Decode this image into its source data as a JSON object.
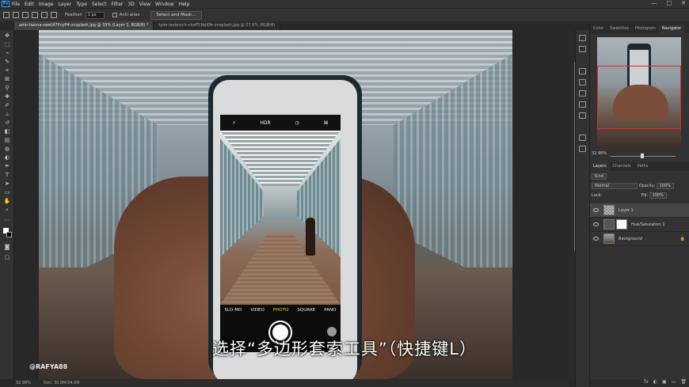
{
  "app": {
    "logo_text": "Ps"
  },
  "menu": [
    "File",
    "Edit",
    "Image",
    "Layer",
    "Type",
    "Select",
    "Filter",
    "3D",
    "View",
    "Window",
    "Help"
  ],
  "window_controls": [
    "—",
    "□",
    "✕"
  ],
  "options": {
    "feather_label": "Feather:",
    "feather_value": "1 px",
    "antialias_label": "Anti-alias",
    "select_mask_label": "Select and Mask..."
  },
  "tabs": [
    {
      "label": "amir-hanna-sweUf7FcyP4-unsplash.jpg @ 33% (Layer 1, RGB/8) *"
    },
    {
      "label": "tyler-lastovich-nhzP53bjlOk-unsplash.jpg @ 27.5% (RGB/8)"
    }
  ],
  "camera": {
    "top": [
      "⚡",
      "HDR",
      "◷",
      "⌘"
    ],
    "modes": [
      "SLO-MO",
      "VIDEO",
      "PHOTO",
      "SQUARE",
      "PANO"
    ],
    "selected_mode": "PHOTO"
  },
  "subtitle": "选择“多边形套索工具”（快捷键L）",
  "watermark": "@RAFYA88",
  "status": {
    "zoom": "32.98%",
    "doc": "Doc: 30.0M/34.0M"
  },
  "panels": {
    "top_tabs": [
      "Color",
      "Swatches",
      "Histogram",
      "Navigator"
    ],
    "top_active": "Navigator",
    "nav_zoom": "32.98%",
    "layer_tabs": [
      "Layers",
      "Channels",
      "Paths"
    ],
    "layer_active": "Layers",
    "kind_label": "Kind",
    "blend_mode": "Normal",
    "opacity_label": "Opacity:",
    "opacity_value": "100%",
    "lock_label": "Lock:",
    "fill_label": "Fill:",
    "fill_value": "100%",
    "layers": [
      {
        "name": "Layer 1",
        "active": true
      },
      {
        "name": "Hue/Saturation 1",
        "active": false
      },
      {
        "name": "Background",
        "active": false
      }
    ],
    "bottom_icons": [
      "fx",
      "◐",
      "▣",
      "▭",
      "🗑"
    ]
  }
}
